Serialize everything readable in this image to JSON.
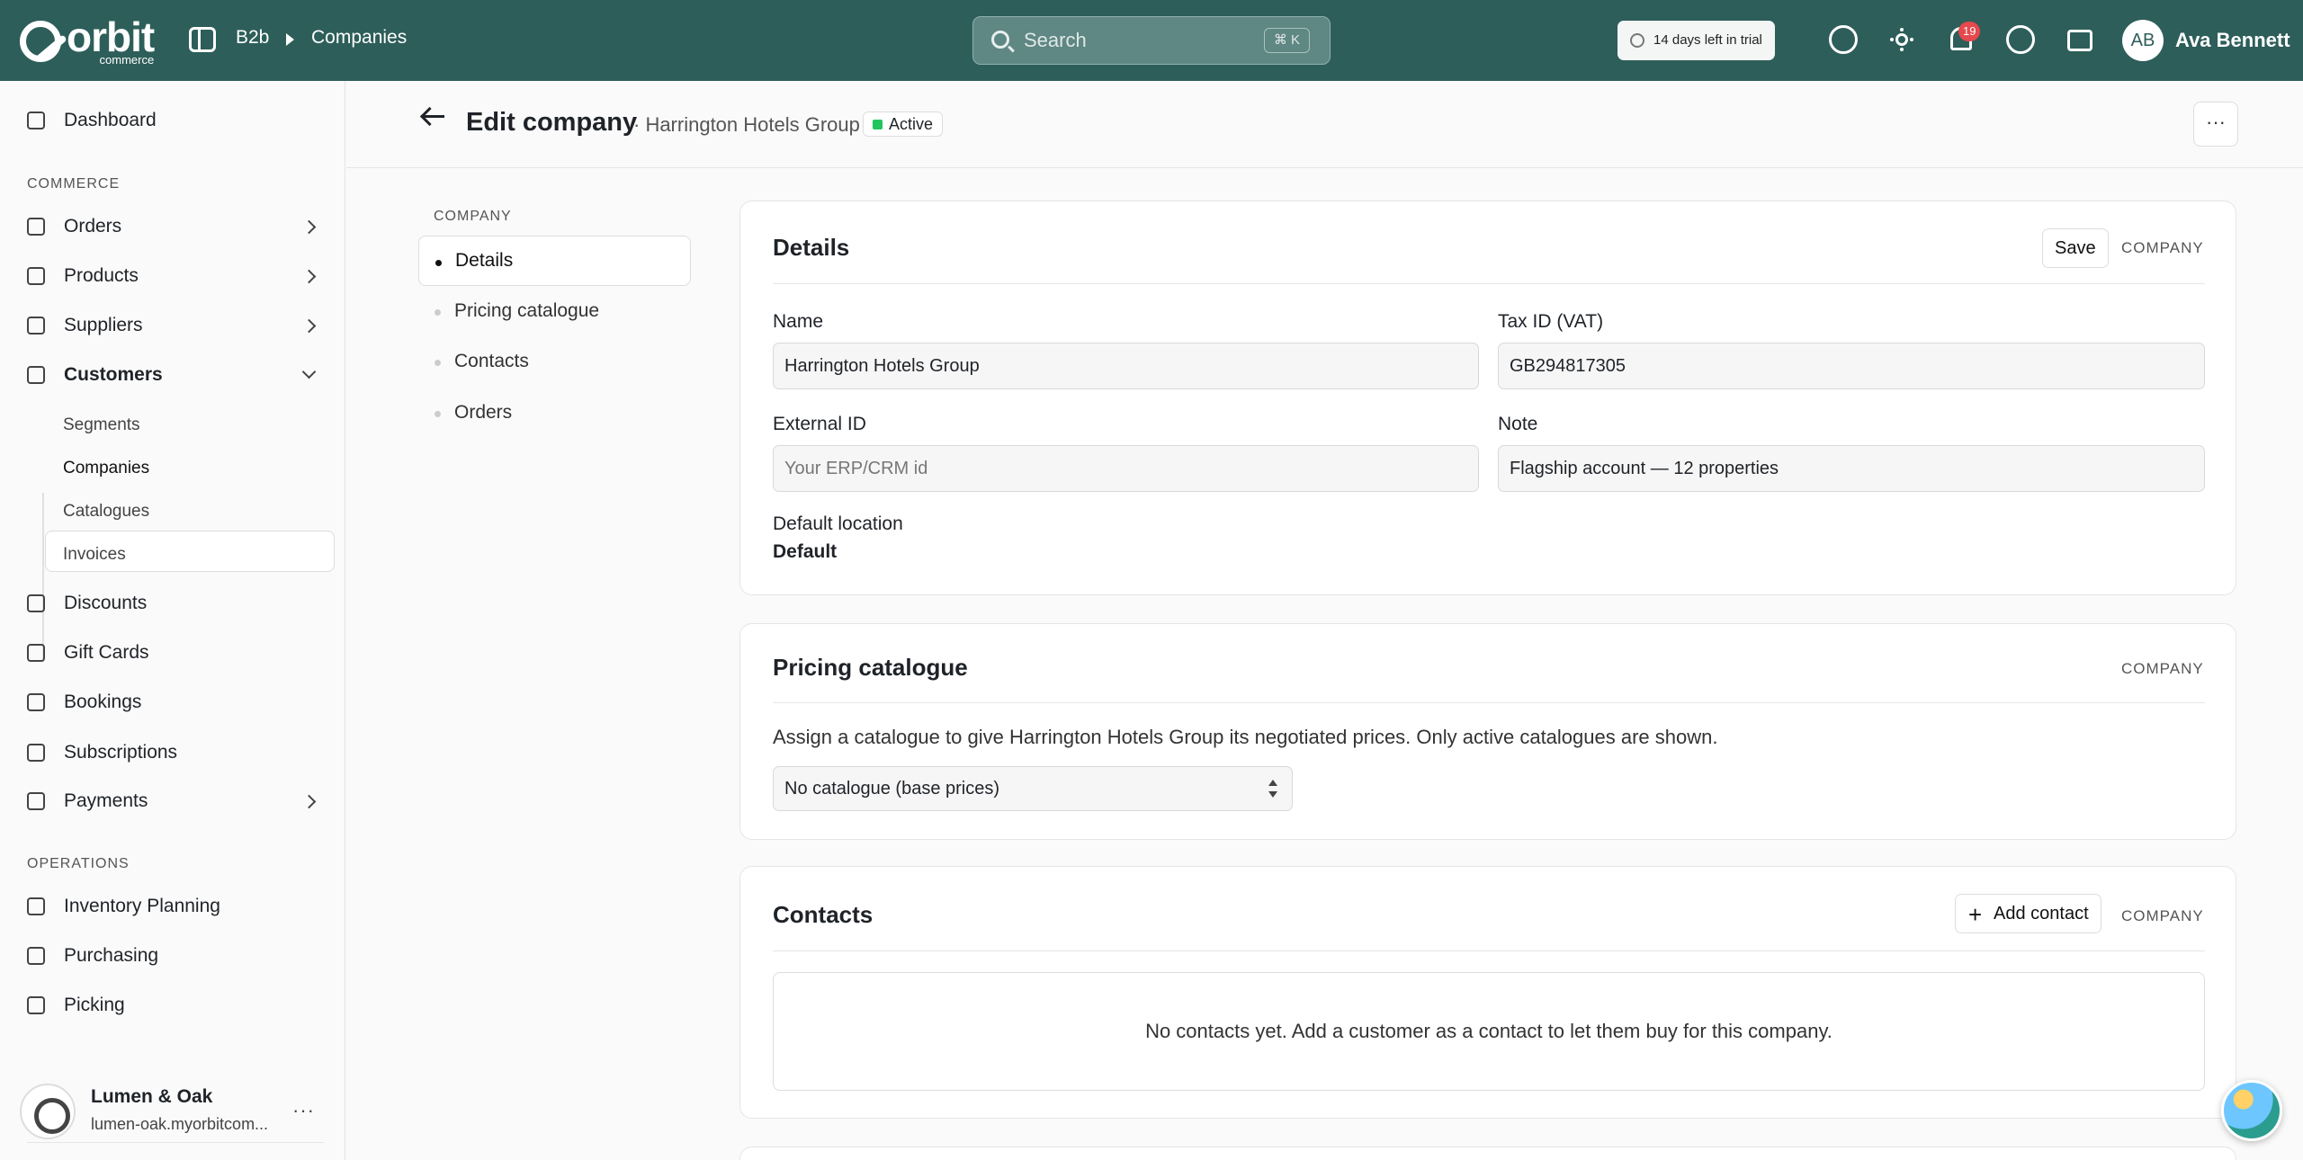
{
  "topbar": {
    "logo_text": "orbit",
    "logo_sub": "commerce",
    "breadcrumb": [
      "B2b",
      "Companies"
    ],
    "search_placeholder": "Search",
    "search_shortcut": "⌘ K",
    "trial_text": "14 days left in trial",
    "notification_count": "19",
    "user_initials": "AB",
    "user_name": "Ava Bennett",
    "accent": "#2d5e5a"
  },
  "sidebar": {
    "dashboard": "Dashboard",
    "commerce_label": "COMMERCE",
    "commerce_items": [
      "Orders",
      "Products",
      "Suppliers",
      "Customers"
    ],
    "customer_sub": [
      "Segments",
      "Companies",
      "Catalogues",
      "Invoices"
    ],
    "more_items": [
      "Discounts",
      "Gift Cards",
      "Bookings",
      "Subscriptions",
      "Payments"
    ],
    "operations_label": "OPERATIONS",
    "operations_items": [
      "Inventory Planning",
      "Purchasing",
      "Picking"
    ],
    "store_name": "Lumen & Oak",
    "store_url": "lumen-oak.myorbitcom...",
    "more": "···"
  },
  "header": {
    "title": "Edit company",
    "subtitle": "· Harrington Hotels Group",
    "status": "Active",
    "more": "···"
  },
  "section_nav": {
    "label": "COMPANY",
    "items": [
      "Details",
      "Pricing catalogue",
      "Contacts",
      "Orders"
    ]
  },
  "details": {
    "title": "Details",
    "save": "Save",
    "tag": "COMPANY",
    "name_label": "Name",
    "name_value": "Harrington Hotels Group",
    "tax_label": "Tax ID (VAT)",
    "tax_value": "GB294817305",
    "external_label": "External ID",
    "external_placeholder": "Your ERP/CRM id",
    "note_label": "Note",
    "note_value": "Flagship account — 12 properties",
    "location_label": "Default location",
    "location_value": "Default"
  },
  "pricing": {
    "title": "Pricing catalogue",
    "tag": "COMPANY",
    "description": "Assign a catalogue to give Harrington Hotels Group its negotiated prices. Only active catalogues are shown.",
    "selected": "No catalogue (base prices)"
  },
  "contacts": {
    "title": "Contacts",
    "add_label": "Add contact",
    "tag": "COMPANY",
    "empty_text": "No contacts yet. Add a customer as a contact to let them buy for this company."
  }
}
